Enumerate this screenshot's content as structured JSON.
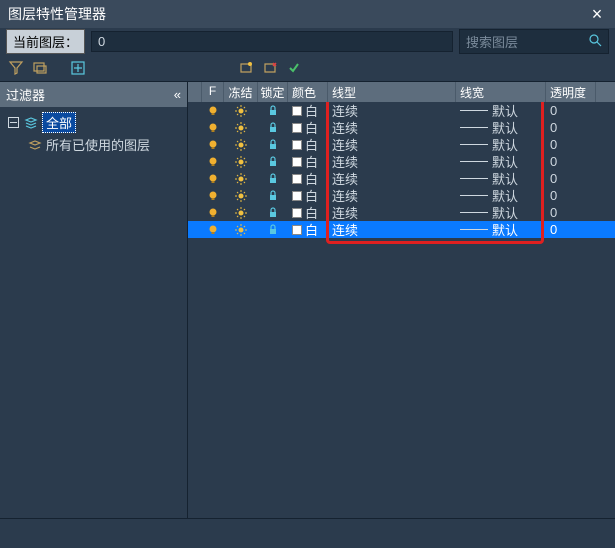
{
  "title": "图层特性管理器",
  "current_layer_label": "当前图层：",
  "current_layer_value": "0",
  "search_placeholder": "搜索图层",
  "filter_header": "过滤器",
  "filter_collapse": "«",
  "tree": {
    "root": "全部",
    "child": "所有已使用的图层"
  },
  "columns": {
    "status": "F",
    "freeze": "冻结",
    "lock": "锁定",
    "color": "颜色",
    "linetype": "线型",
    "lineweight": "线宽",
    "transparency": "透明度"
  },
  "color_name": "白",
  "linetype_val": "连续",
  "lineweight_val": "默认",
  "rows": [
    {
      "trans": "0",
      "selected": false
    },
    {
      "trans": "0",
      "selected": false
    },
    {
      "trans": "0",
      "selected": false
    },
    {
      "trans": "0",
      "selected": false
    },
    {
      "trans": "0",
      "selected": false
    },
    {
      "trans": "0",
      "selected": false
    },
    {
      "trans": "0",
      "selected": false
    },
    {
      "trans": "0",
      "selected": true
    }
  ]
}
